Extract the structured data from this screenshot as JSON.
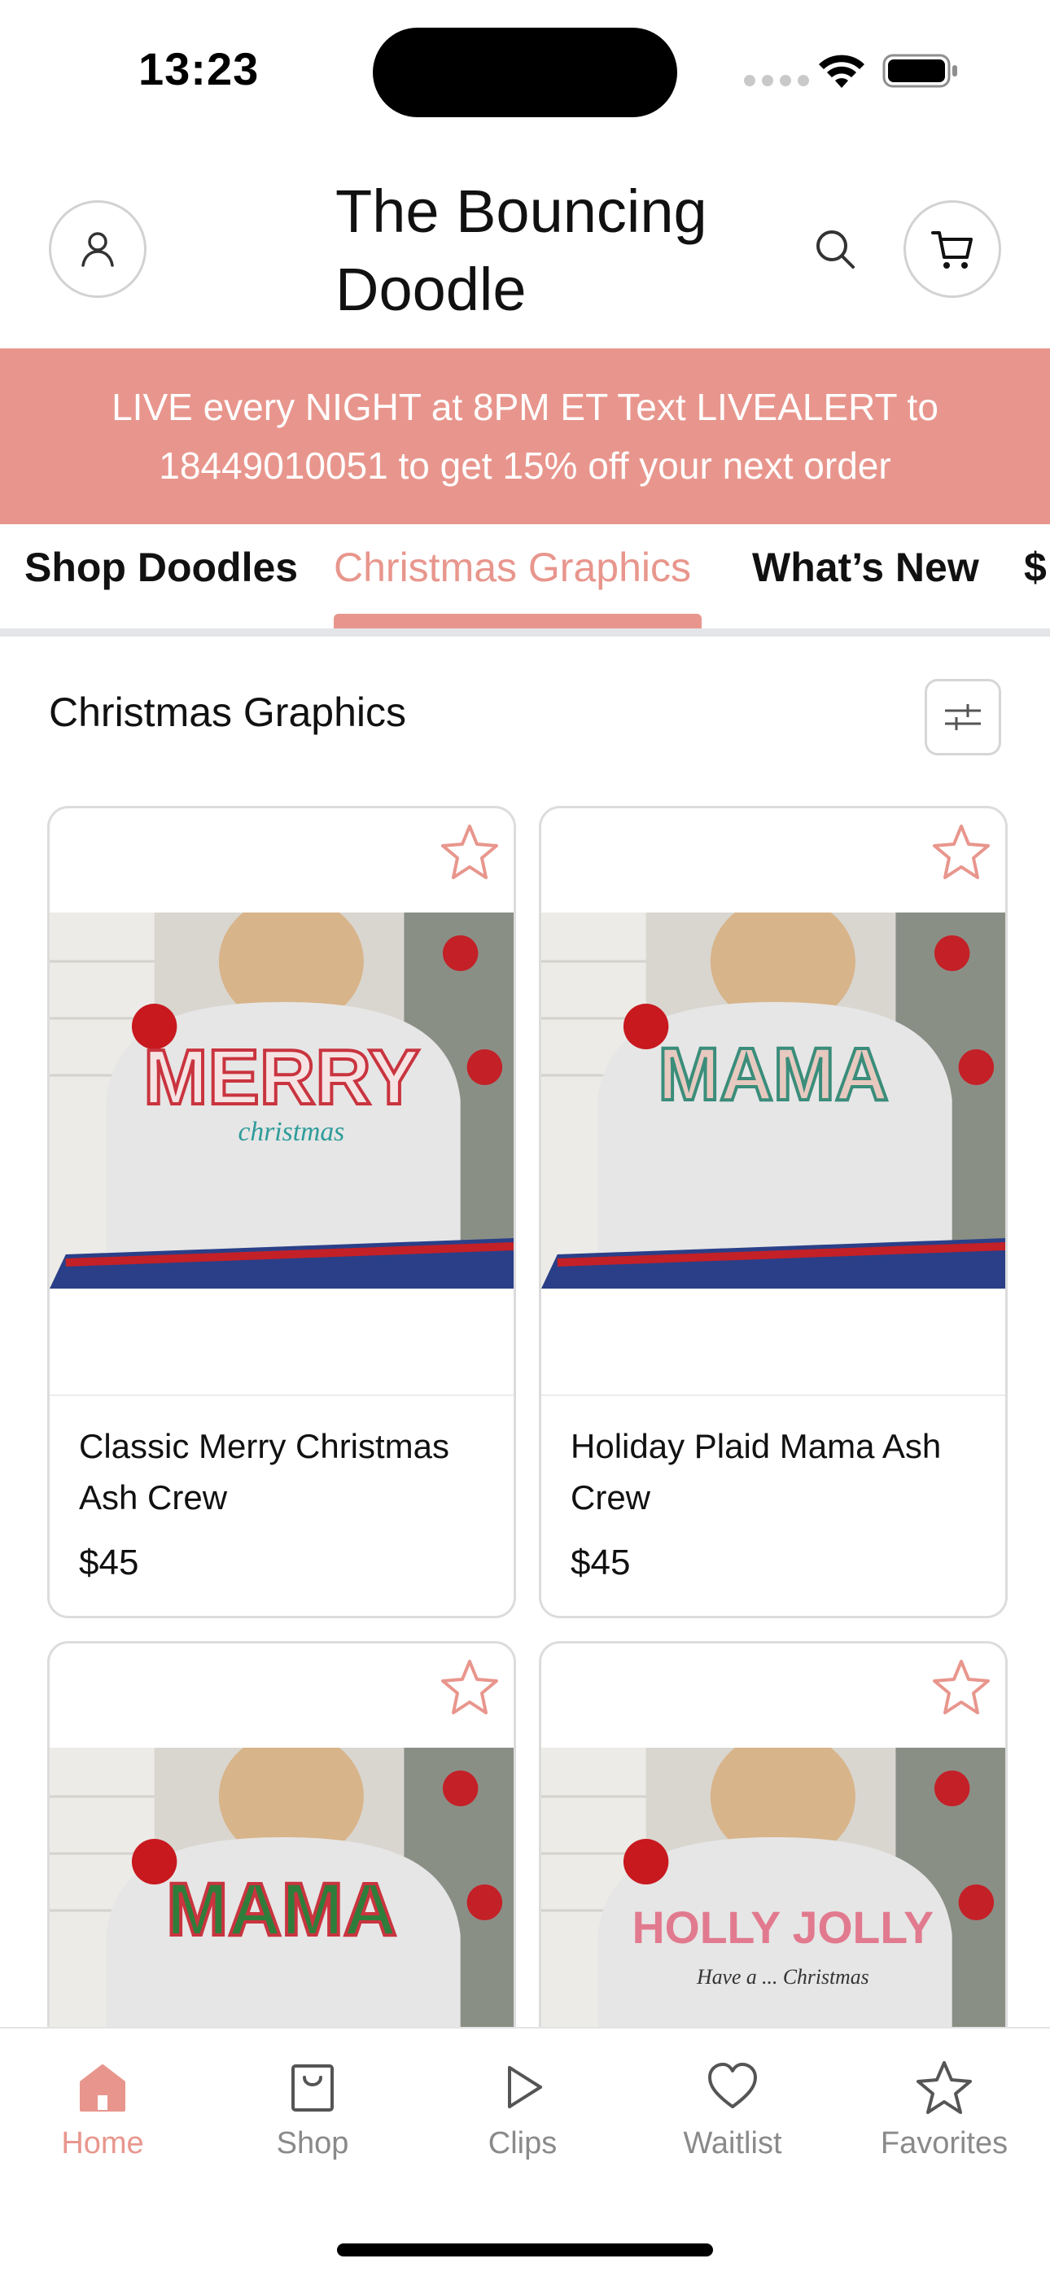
{
  "status_bar": {
    "time": "13:23"
  },
  "header": {
    "title": "The Bouncing Doodle",
    "account_icon": "user-icon",
    "search_icon": "search-icon",
    "cart_icon": "cart-icon"
  },
  "promo": {
    "text": "LIVE every NIGHT at 8PM ET Text LIVEALERT to 18449010051 to get 15% off your next order"
  },
  "tabs": [
    {
      "label": "Shop Doodles"
    },
    {
      "label": "Christmas Graphics"
    },
    {
      "label": "What’s New"
    },
    {
      "label": "$"
    }
  ],
  "active_tab": "Christmas Graphics",
  "section": {
    "title": "Christmas Graphics",
    "filter_icon": "sliders-icon"
  },
  "products": [
    {
      "name": "Classic Merry Christmas Ash Crew",
      "price": "$45",
      "graphic": "MERRY",
      "sub": "christmas"
    },
    {
      "name": "Holiday Plaid Mama Ash Crew",
      "price": "$45",
      "graphic": "MAMA",
      "sub": ""
    },
    {
      "name": "",
      "price": "",
      "graphic": "MAMA",
      "sub": ""
    },
    {
      "name": "",
      "price": "",
      "graphic": "HOLLY JOLLY",
      "sub": "Have a ... Christmas"
    }
  ],
  "bottom_nav": [
    {
      "label": "Home",
      "icon": "home-icon"
    },
    {
      "label": "Shop",
      "icon": "shopping-bag-icon"
    },
    {
      "label": "Clips",
      "icon": "play-icon"
    },
    {
      "label": "Waitlist",
      "icon": "heart-icon"
    },
    {
      "label": "Favorites",
      "icon": "star-icon"
    }
  ],
  "colors": {
    "accent": "#e8968d",
    "text": "#111111",
    "muted": "#8a8a8a",
    "divider": "#e3e5e8"
  }
}
